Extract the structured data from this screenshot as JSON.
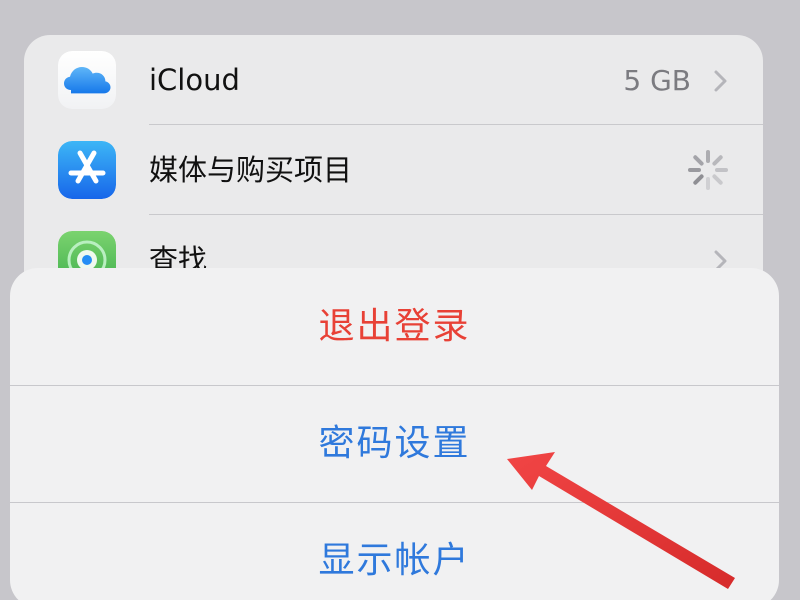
{
  "settings": {
    "items": [
      {
        "label": "iCloud",
        "value": "5 GB",
        "icon": "icloud-icon"
      },
      {
        "label": "媒体与购买项目",
        "icon": "app-store-icon",
        "status": "loading-spinner"
      },
      {
        "label": "查找",
        "icon": "find-my-icon"
      }
    ]
  },
  "action_sheet": {
    "logout_label": "退出登录",
    "password_settings_label": "密码设置",
    "view_account_label": "显示帐户"
  },
  "colors": {
    "destructive": "#e84136",
    "action": "#2f79dc",
    "annotation_arrow": "#ee3434"
  }
}
